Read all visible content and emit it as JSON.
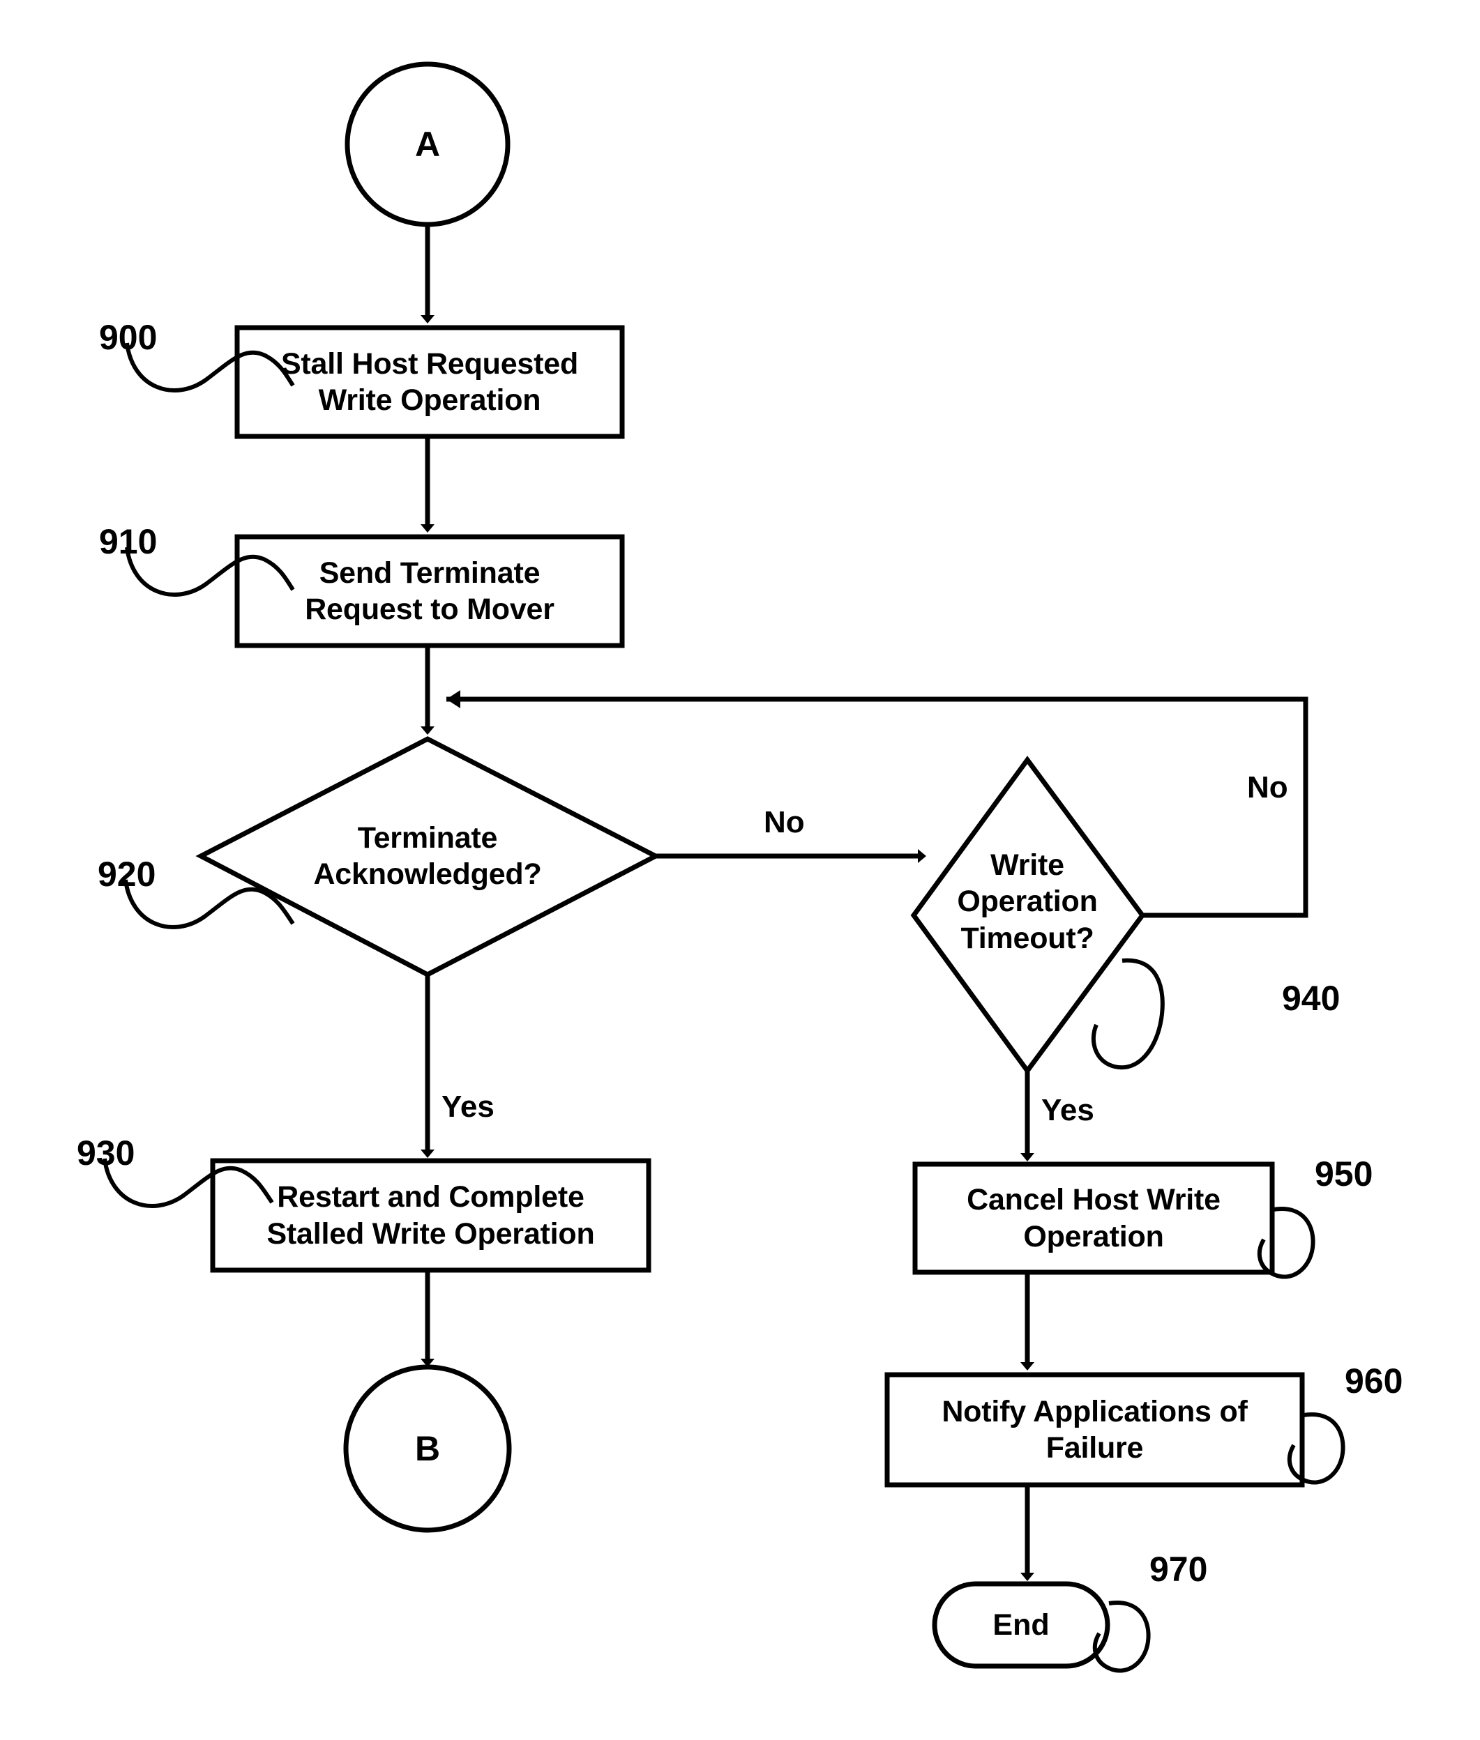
{
  "figure": {
    "type": "flowchart",
    "title": "",
    "background_color": "#ffffff",
    "line_color": "#000000"
  },
  "nodes": {
    "connector_a": {
      "label": "A",
      "shape": "circle",
      "ref": ""
    },
    "step_900": {
      "label": "Stall Host Requested\nWrite Operation",
      "shape": "process",
      "ref": "900"
    },
    "step_910": {
      "label": "Send Terminate\nRequest to Mover",
      "shape": "process",
      "ref": "910"
    },
    "decision_920": {
      "label": "Terminate\nAcknowledged?",
      "shape": "decision",
      "ref": "920"
    },
    "step_930": {
      "label": "Restart and Complete\nStalled Write Operation",
      "shape": "process",
      "ref": "930"
    },
    "decision_940": {
      "label": "Write\nOperation\nTimeout?",
      "shape": "decision",
      "ref": "940"
    },
    "step_950": {
      "label": "Cancel Host Write\nOperation",
      "shape": "process",
      "ref": "950"
    },
    "step_960": {
      "label": "Notify Applications of\nFailure",
      "shape": "process",
      "ref": "960"
    },
    "terminator_970": {
      "label": "End",
      "shape": "terminator",
      "ref": "970"
    },
    "connector_b": {
      "label": "B",
      "shape": "circle",
      "ref": ""
    }
  },
  "edge_labels": {
    "no_920_to_940": "No",
    "yes_920_to_930": "Yes",
    "no_940_loopback": "No",
    "yes_940_to_950": "Yes"
  },
  "reference_numerals": {
    "r900": "900",
    "r910": "910",
    "r920": "920",
    "r930": "930",
    "r940": "940",
    "r950": "950",
    "r960": "960",
    "r970": "970"
  }
}
